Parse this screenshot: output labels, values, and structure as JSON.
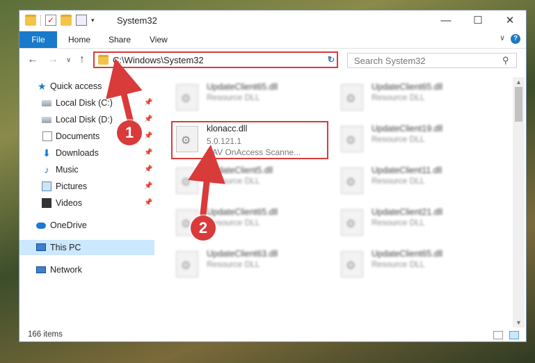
{
  "window": {
    "title": "System32",
    "controls": {
      "minimize": "—",
      "maximize": "☐",
      "close": "✕"
    }
  },
  "ribbon": {
    "tabs": [
      "File",
      "Home",
      "Share",
      "View"
    ],
    "help": "?"
  },
  "address": {
    "path": "C:\\Windows\\System32",
    "search_placeholder": "Search System32"
  },
  "nav": {
    "items": [
      {
        "label": "Quick access",
        "pinned": false
      },
      {
        "label": "Local Disk (C:)",
        "pinned": true
      },
      {
        "label": "Local Disk (D:)",
        "pinned": true
      },
      {
        "label": "Documents",
        "pinned": true
      },
      {
        "label": "Downloads",
        "pinned": true
      },
      {
        "label": "Music",
        "pinned": true
      },
      {
        "label": "Pictures",
        "pinned": true
      },
      {
        "label": "Videos",
        "pinned": true
      },
      {
        "label": "OneDrive",
        "pinned": false
      },
      {
        "label": "This PC",
        "pinned": false,
        "selected": true
      },
      {
        "label": "Network",
        "pinned": false
      }
    ]
  },
  "files": [
    {
      "name": "UpdateClient65.dll",
      "desc": "Resource DLL",
      "blurred": true
    },
    {
      "name": "UpdateClient65.dll",
      "desc": "Resource DLL",
      "blurred": true
    },
    {
      "name": "klonacc.dll",
      "version": "5.0.121.1",
      "desc": "KAV OnAccess Scanne...",
      "blurred": false
    },
    {
      "name": "UpdateClient19.dll",
      "desc": "Resource DLL",
      "blurred": true
    },
    {
      "name": "UpdateClient5.dll",
      "desc": "Resource DLL",
      "blurred": true
    },
    {
      "name": "UpdateClient11.dll",
      "desc": "Resource DLL",
      "blurred": true
    },
    {
      "name": "UpdateClient65.dll",
      "desc": "Resource DLL",
      "blurred": true
    },
    {
      "name": "UpdateClient21.dll",
      "desc": "Resource DLL",
      "blurred": true
    },
    {
      "name": "UpdateClient63.dll",
      "desc": "Resource DLL",
      "blurred": true
    },
    {
      "name": "UpdateClient65.dll",
      "desc": "Resource DLL",
      "blurred": true
    }
  ],
  "status": {
    "count": "166 items"
  },
  "annotations": {
    "step1": "1",
    "step2": "2",
    "color": "#d93a3a"
  }
}
